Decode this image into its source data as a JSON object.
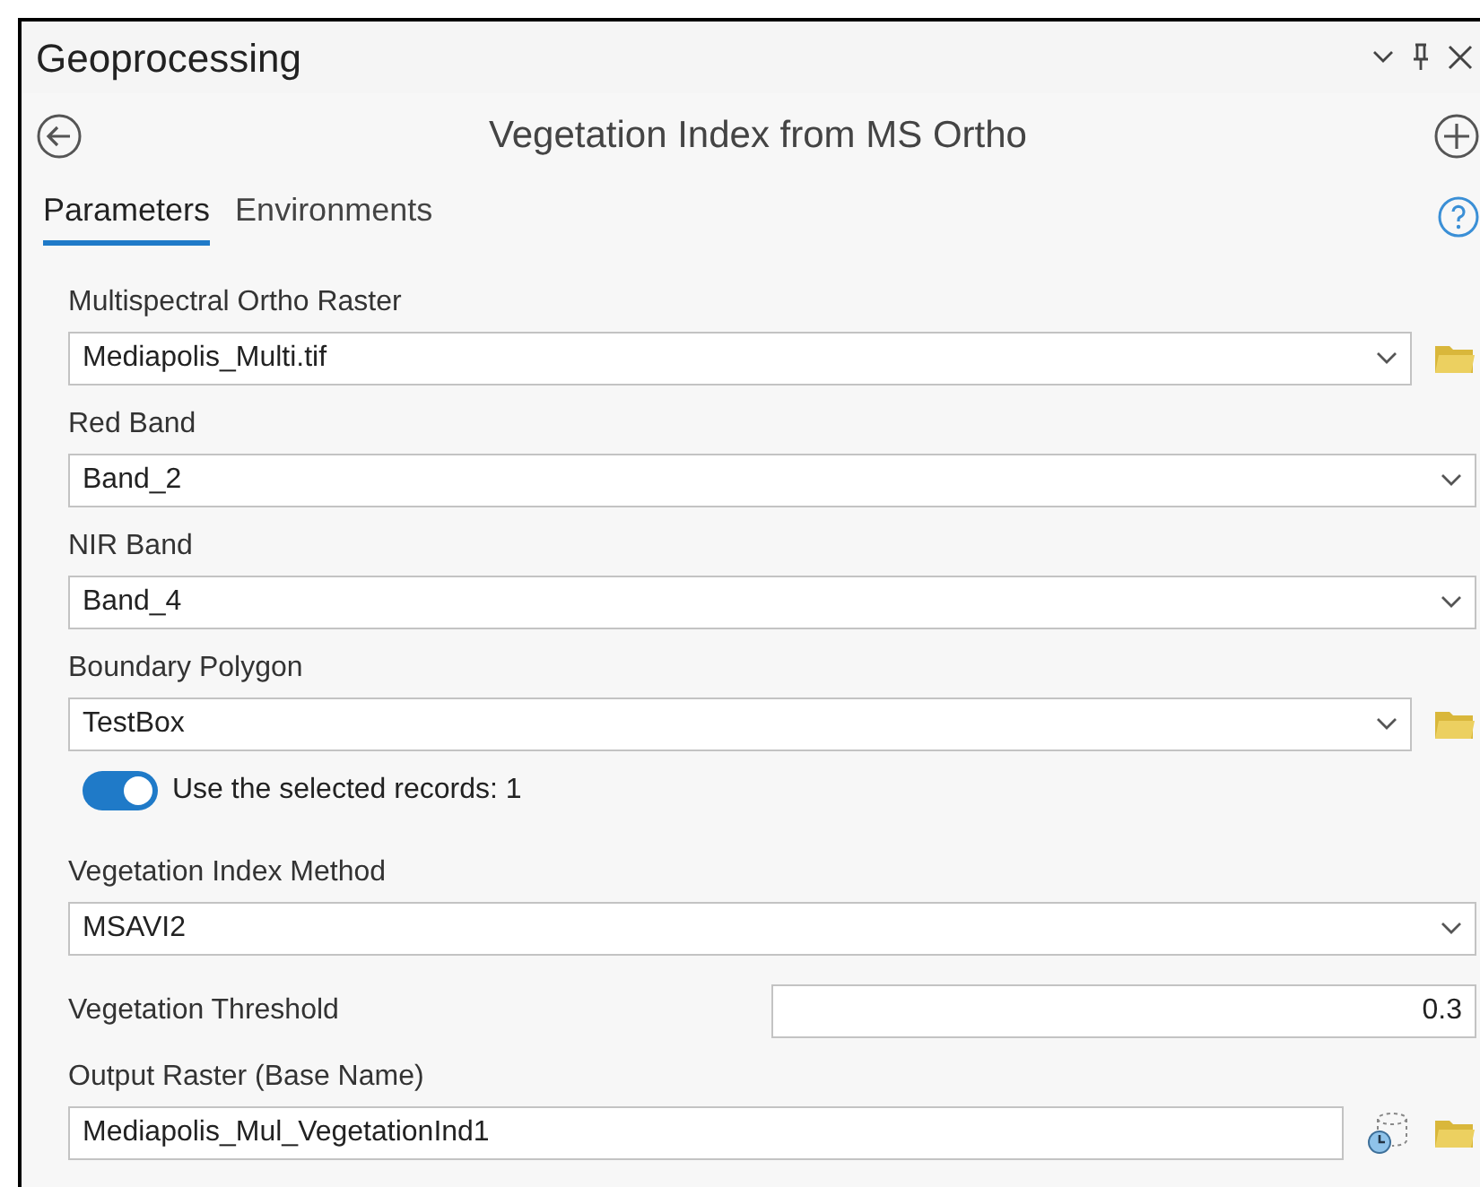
{
  "panel": {
    "title": "Geoprocessing"
  },
  "tool": {
    "title": "Vegetation Index from MS Ortho"
  },
  "tabs": [
    {
      "label": "Parameters",
      "selected": true
    },
    {
      "label": "Environments",
      "selected": false
    }
  ],
  "parameters": [
    {
      "kind": "dropdown",
      "label": "Multispectral Ortho Raster",
      "value": "Mediapolis_Multi.tif",
      "browse": true
    },
    {
      "kind": "dropdown",
      "label": "Red Band",
      "value": "Band_2",
      "browse": false
    },
    {
      "kind": "dropdown",
      "label": "NIR Band",
      "value": "Band_4",
      "browse": false
    },
    {
      "kind": "dropdown",
      "label": "Boundary Polygon",
      "value": "TestBox",
      "browse": true
    },
    {
      "kind": "toggle",
      "label": "Use the selected records: 1",
      "on": true
    },
    {
      "kind": "dropdown",
      "label": "Vegetation Index Method",
      "value": "MSAVI2",
      "browse": false
    },
    {
      "kind": "number",
      "label": "Vegetation Threshold",
      "value": "0.3"
    },
    {
      "kind": "output",
      "label": "Output Raster (Base Name)",
      "value": "Mediapolis_Mul_VegetationInd1"
    }
  ]
}
